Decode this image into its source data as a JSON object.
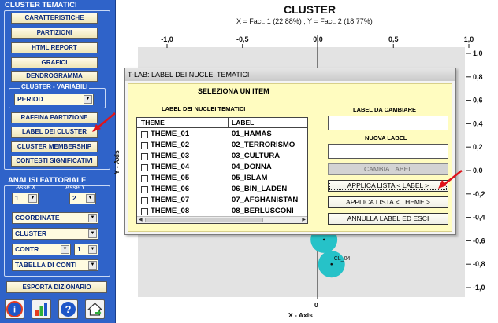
{
  "left_panel": {
    "cluster_group_title": "CLUSTER TEMATICI",
    "buttons": [
      "CARATTERISTICHE",
      "PARTIZIONI",
      "HTML REPORT",
      "GRAFICI",
      "DENDROGRAMMA"
    ],
    "variables_group_title": "CLUSTER - VARIABILI",
    "variable_select": "PERIOD",
    "buttons2": [
      "RAFFINA PARTIZIONE",
      "LABEL DEI CLUSTER",
      "CLUSTER MEMBERSHIP",
      "CONTESTI SIGNIFICATIVI"
    ],
    "factorial_group_title": "ANALISI FATTORIALE",
    "axis_x_label": "Asse X",
    "axis_y_label": "Asse Y",
    "axis_x_value": "1",
    "axis_y_value": "2",
    "coordinate_select": "COORDINATE",
    "cluster_select": "CLUSTER",
    "contr_select": "CONTR",
    "contr_num": "1",
    "table_select": "TABELLA DI CONTI",
    "export_button": "ESPORTA DIZIONARIO",
    "bottom_icons": [
      "info-icon",
      "chart-icon",
      "help-icon",
      "home-icon"
    ]
  },
  "chart": {
    "title": "CLUSTER",
    "subtitle": "X = Fact. 1 (22,88%) ; Y = Fact. 2 (18,77%)",
    "xlabel": "X - Axis",
    "ylabel": "Y - Axis",
    "origin_label": "0"
  },
  "chart_data": {
    "type": "scatter",
    "title": "CLUSTER",
    "subtitle": "X = Fact. 1 (22,88%) ; Y = Fact. 2 (18,77%)",
    "xlabel": "X - Axis",
    "ylabel": "Y - Axis",
    "xlim": [
      -1.0,
      1.0
    ],
    "ylim": [
      -1.0,
      1.0
    ],
    "x_ticks": [
      "-1,0",
      "-0,5",
      "0,0",
      "0,5",
      "1,0"
    ],
    "y_ticks": [
      "1,0",
      "0,8",
      "0,6",
      "0,4",
      "0,2",
      "0,0",
      "-0,2",
      "-0,4",
      "-0,6",
      "-0,8",
      "-1,0"
    ],
    "points": [
      {
        "label": "CL_04",
        "x": 0.09,
        "y": -0.8
      },
      {
        "label": "",
        "x": 0.04,
        "y": -0.59
      }
    ],
    "point_color": "#26c2c8",
    "background_color": "#e3e3e3"
  },
  "dialog": {
    "title": "T-LAB: LABEL DEI NUCLEI TEMATICI",
    "heading": "SELEZIONA UN ITEM",
    "list_title": "LABEL DEI NUCLEI TEMATICI",
    "col_theme": "THEME",
    "col_label": "LABEL",
    "rows": [
      {
        "theme": "THEME_01",
        "label": "01_HAMAS"
      },
      {
        "theme": "THEME_02",
        "label": "02_TERRORISMO"
      },
      {
        "theme": "THEME_03",
        "label": "03_CULTURA"
      },
      {
        "theme": "THEME_04",
        "label": "04_DONNA"
      },
      {
        "theme": "THEME_05",
        "label": "05_ISLAM"
      },
      {
        "theme": "THEME_06",
        "label": "06_BIN_LADEN"
      },
      {
        "theme": "THEME_07",
        "label": "07_AFGHANISTAN"
      },
      {
        "theme": "THEME_08",
        "label": "08_BERLUSCONI"
      }
    ],
    "label_to_change": "LABEL DA CAMBIARE",
    "label_to_change_value": "",
    "new_label": "NUOVA LABEL",
    "new_label_value": "",
    "btn_change": "CAMBIA LABEL",
    "btn_apply_label": "APPLICA LISTA < LABEL >",
    "btn_apply_theme": "APPLICA LISTA < THEME >",
    "btn_cancel": "ANNULLA LABEL ED ESCI"
  },
  "colors": {
    "panel_blue": "#2f63c9",
    "button_text": "#0b2a7a",
    "dialog_body": "#fffcc0",
    "arrow_red": "#e0141a"
  }
}
